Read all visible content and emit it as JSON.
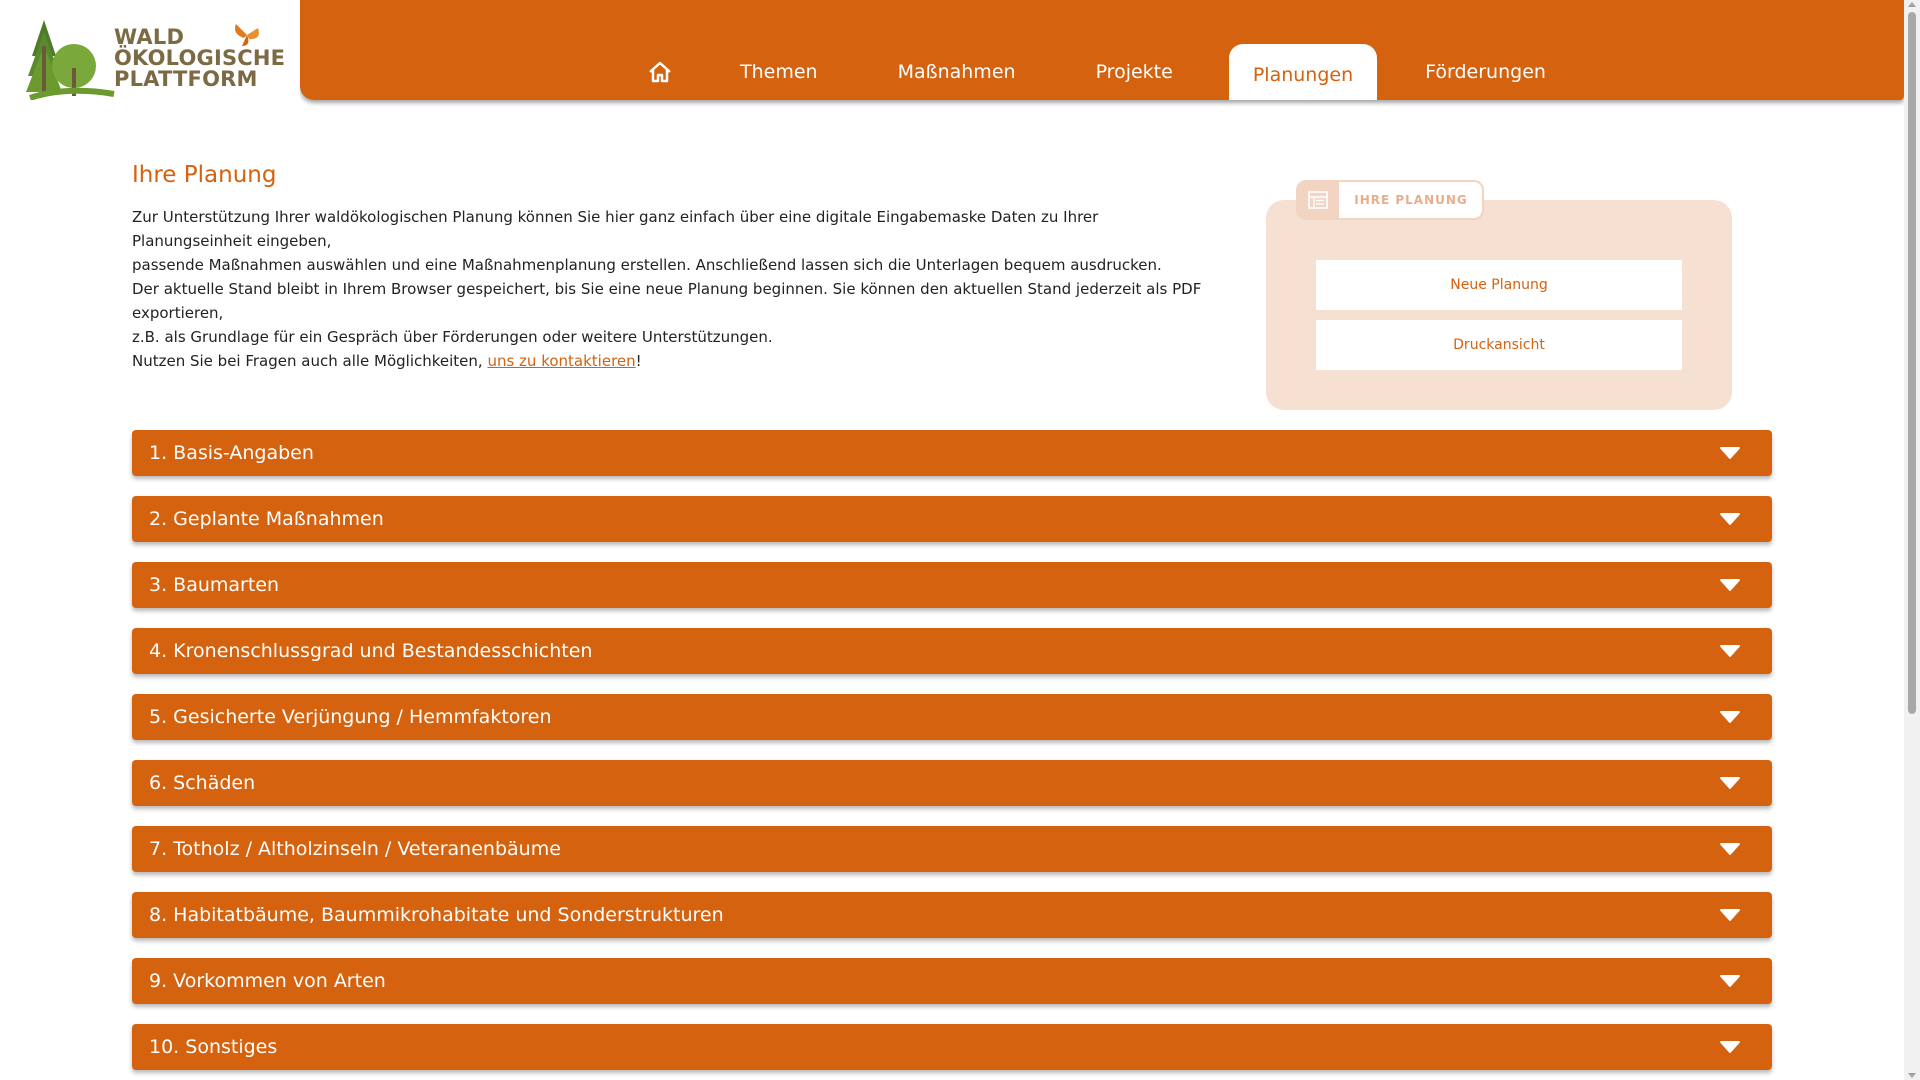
{
  "brand": {
    "logo_line1": "WALD",
    "logo_line2": "ÖKOLOGISCHE",
    "logo_line3": "PLATTFORM",
    "primary_color": "#d4620f",
    "logo_green": "#6b9a2e"
  },
  "nav": {
    "home_icon": "home-icon",
    "items": [
      {
        "label": "Themen"
      },
      {
        "label": "Maßnahmen"
      },
      {
        "label": "Projekte"
      },
      {
        "label": "Planungen",
        "active": true
      },
      {
        "label": "Förderungen"
      }
    ]
  },
  "intro": {
    "title": "Ihre Planung",
    "line1": "Zur Unterstützung Ihrer waldökologischen Planung können Sie hier ganz einfach über eine digitale Eingabemaske Daten zu Ihrer Planungseinheit eingeben,",
    "line2": "passende Maßnahmen auswählen und eine Maßnahmenplanung erstellen. Anschließend lassen sich die Unterlagen bequem ausdrucken.",
    "line3": "Der aktuelle Stand bleibt in Ihrem Browser gespeichert, bis Sie eine neue Planung beginnen. Sie können den aktuellen Stand jederzeit als PDF exportieren,",
    "line4": "z.B. als Grundlage für ein Gespräch über Förderungen oder weitere Unterstützungen.",
    "line5_prefix": "Nutzen Sie bei Fragen auch alle Möglichkeiten, ",
    "contact_link": "uns zu kontaktieren",
    "line5_suffix": "!"
  },
  "plan_box": {
    "tab_label": "IHRE PLANUNG",
    "tab_icon": "list-icon",
    "new_button": "Neue Planung",
    "print_button": "Druckansicht"
  },
  "sections": [
    {
      "label": "1. Basis-Angaben"
    },
    {
      "label": "2. Geplante Maßnahmen"
    },
    {
      "label": "3. Baumarten"
    },
    {
      "label": "4. Kronenschlussgrad und Bestandesschichten"
    },
    {
      "label": "5. Gesicherte Verjüngung / Hemmfaktoren"
    },
    {
      "label": "6. Schäden"
    },
    {
      "label": "7. Totholz / Altholzinseln / Veteranenbäume"
    },
    {
      "label": "8. Habitatbäume, Baummikrohabitate und Sonderstrukturen"
    },
    {
      "label": "9. Vorkommen von Arten"
    },
    {
      "label": "10. Sonstiges"
    }
  ]
}
